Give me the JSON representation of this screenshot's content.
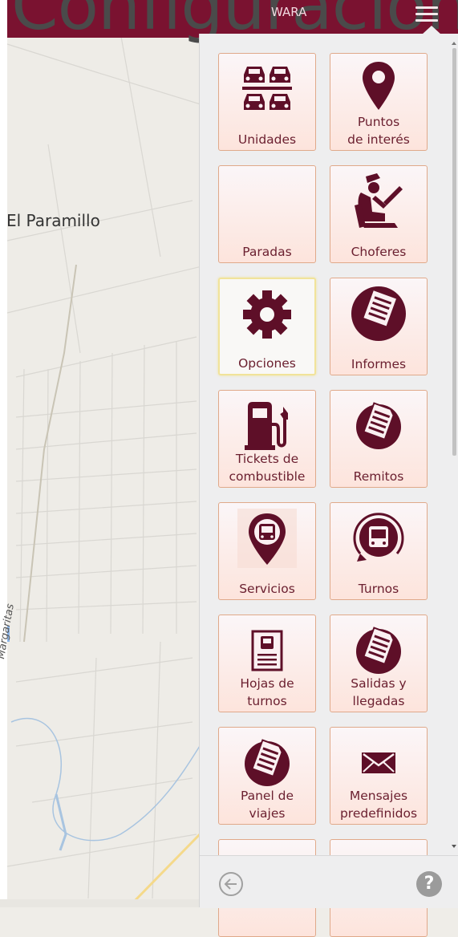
{
  "header": {
    "title": "Configuración",
    "user_label": "WARA",
    "menu_icon": "hamburger-icon"
  },
  "map": {
    "place_label": "El Paramillo",
    "street_label": "Margaritas"
  },
  "menu": {
    "tiles": [
      {
        "label_lines": [
          "Unidades"
        ],
        "icon": "vehicles-icon"
      },
      {
        "label_lines": [
          "Puntos",
          "de interés"
        ],
        "icon": "map-pin-icon"
      },
      {
        "label_lines": [
          "Paradas"
        ],
        "icon": "none"
      },
      {
        "label_lines": [
          "Choferes"
        ],
        "icon": "driver-icon"
      },
      {
        "label_lines": [
          "Opciones"
        ],
        "icon": "gear-icon",
        "selected": true
      },
      {
        "label_lines": [
          "Informes"
        ],
        "icon": "report-icon"
      },
      {
        "label_lines": [
          "Tickets de",
          "combustible"
        ],
        "icon": "fuel-pump-icon"
      },
      {
        "label_lines": [
          "Remitos"
        ],
        "icon": "document-icon"
      },
      {
        "label_lines": [
          "Servicios"
        ],
        "icon": "bus-pin-icon"
      },
      {
        "label_lines": [
          "Turnos"
        ],
        "icon": "bus-cycle-icon"
      },
      {
        "label_lines": [
          "Hojas de",
          "turnos"
        ],
        "icon": "bus-sheet-icon"
      },
      {
        "label_lines": [
          "Salidas y",
          "llegadas"
        ],
        "icon": "document-icon"
      },
      {
        "label_lines": [
          "Panel de",
          "viajes"
        ],
        "icon": "document-icon"
      },
      {
        "label_lines": [
          "Mensajes",
          "predefinidos"
        ],
        "icon": "envelope-icon"
      }
    ]
  },
  "footer": {
    "back_icon": "back-arrow-icon",
    "help_label": "?"
  },
  "colors": {
    "brand": "#7a1230",
    "icon": "#5e0f28",
    "label": "#6b2030",
    "tile_border": "#e0a98a"
  }
}
